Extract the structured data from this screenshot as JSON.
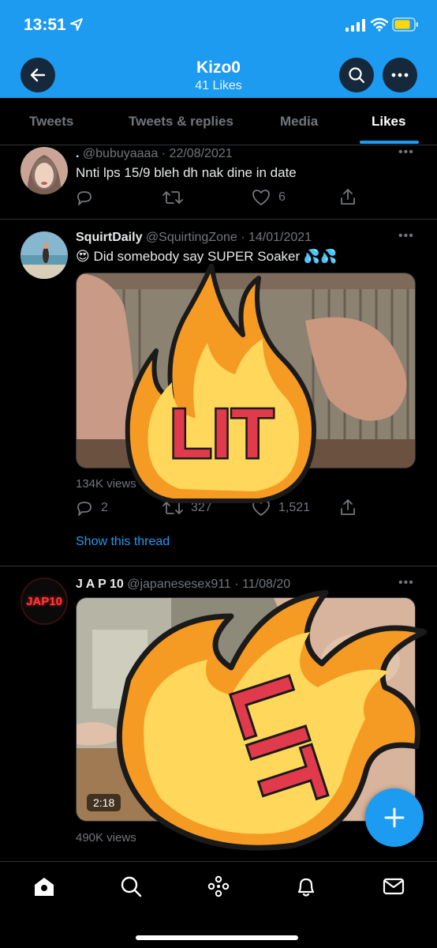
{
  "status": {
    "time": "13:51"
  },
  "header": {
    "title": "Kizo0",
    "subtitle": "41 Likes"
  },
  "tabs": [
    {
      "label": "Tweets"
    },
    {
      "label": "Tweets & replies"
    },
    {
      "label": "Media"
    },
    {
      "label": "Likes",
      "active": true
    }
  ],
  "tweets": [
    {
      "name": ".",
      "handle_date": "@bubuyaaaa · 22/08/2021",
      "text": "Nnti lps 15/9 bleh dh nak dine in date",
      "reply_count": "",
      "retweet_count": "",
      "like_count": "6"
    },
    {
      "name": "SquirtDaily",
      "handle_date": "@SquirtingZone · 14/01/2021",
      "text": "😍 Did somebody say SUPER Soaker 💦💦",
      "views": "134K views",
      "reply_count": "2",
      "retweet_count": "327",
      "like_count": "1,521",
      "thread_link": "Show this thread",
      "sticker_text": "LIT"
    },
    {
      "name": "J A P 10",
      "handle_date": "@japanesesex911 · 11/08/20",
      "avatar_text": "JAP10",
      "video_duration": "2:18",
      "views": "490K views",
      "sticker_text": "LIT"
    }
  ],
  "colors": {
    "accent": "#1d9bf0",
    "background": "#000000",
    "muted": "#71767b",
    "sticker_red": "#e03a4c",
    "sticker_orange": "#f59a23",
    "sticker_yellow": "#ffd75a"
  },
  "icons": [
    "back-arrow-icon",
    "search-icon",
    "more-icon",
    "reply-icon",
    "retweet-icon",
    "like-icon",
    "share-icon",
    "home-icon",
    "explore-icon",
    "spaces-icon",
    "notifications-icon",
    "messages-icon",
    "compose-icon"
  ]
}
